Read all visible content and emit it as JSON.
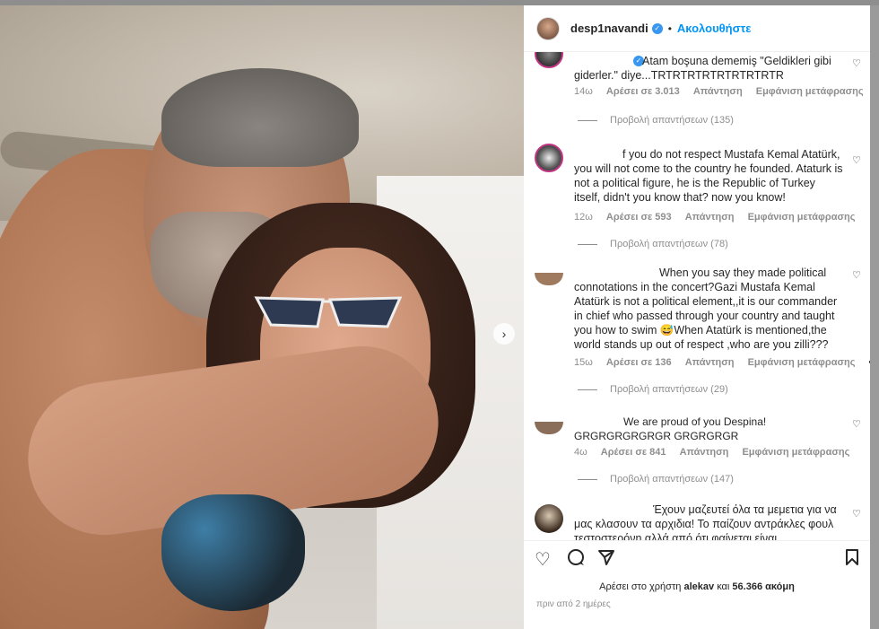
{
  "header": {
    "username": "desp1navandi",
    "follow_label": "Ακολουθήστε",
    "separator": "•"
  },
  "comments": [
    {
      "text": "Atam boşuna dememiş \"Geldikleri gibi giderler.\" diye...TRTRTRTRTRTRTRTRTR",
      "time": "14ω",
      "likes": "Αρέσει σε 3.013",
      "reply": "Απάντηση",
      "translate": "Εμφάνιση μετάφρασης",
      "view_replies": "Προβολή απαντήσεων (135)"
    },
    {
      "text": "f you do not respect Mustafa Kemal Atatürk, you will not come to the country he founded. Ataturk is not a political figure, he is the Republic of Turkey itself, didn't you know that? now you know!",
      "time": "12ω",
      "likes": "Αρέσει σε 593",
      "reply": "Απάντηση",
      "translate": "Εμφάνιση μετάφρασης",
      "view_replies": "Προβολή απαντήσεων (78)"
    },
    {
      "text": "When you say they made political connotations in the concert?Gazi Mustafa Kemal Atatürk is not a political element,,it is our commander in chief who passed through your country and taught you how to swim 😅When Atatürk is mentioned,the world stands up out of respect ,who are you zilli???",
      "time": "15ω",
      "likes": "Αρέσει σε 136",
      "reply": "Απάντηση",
      "translate": "Εμφάνιση μετάφρασης",
      "more": "•••",
      "view_replies": "Προβολή απαντήσεων (29)"
    },
    {
      "text": "We are proud of you Despina! GRGRGRGRGRGR GRGRGRGR",
      "time": "4ω",
      "likes": "Αρέσει σε 841",
      "reply": "Απάντηση",
      "translate": "Εμφάνιση μετάφρασης",
      "view_replies": "Προβολή απαντήσεων (147)"
    },
    {
      "text": "Έχουν μαζευτεί όλα τα μεμετια για να μας κλασουν τα αρχιδια! Το παίζουν αντράκλες φουλ τεστοστερόνη αλλά από ότι φαίνεται είναι"
    }
  ],
  "actions": {
    "like_icon": "heart-icon",
    "comment_icon": "comment-icon",
    "share_icon": "send-icon",
    "save_icon": "bookmark-icon"
  },
  "liked_by": {
    "prefix": "Αρέσει στο χρήστη",
    "user": "alekav",
    "conj": "και",
    "others": "56.366 ακόμη"
  },
  "timestamp": "πριν από 2 ημέρες",
  "colors": {
    "accent": "#0095f6",
    "verified": "#3897f0",
    "text": "#262626",
    "muted": "#8e8e8e"
  }
}
